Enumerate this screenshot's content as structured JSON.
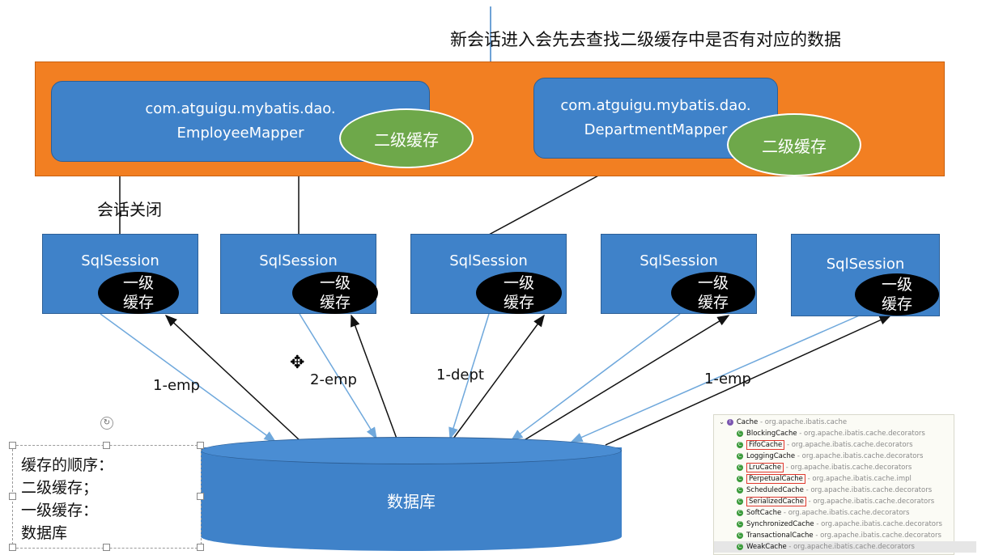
{
  "top_note": "新会话进入会先去查找二级缓存中是否有对应的数据",
  "mappers": [
    {
      "line1": "com.atguigu.mybatis.dao.",
      "line2": "EmployeeMapper",
      "cache": "二级缓存"
    },
    {
      "line1": "com.atguigu.mybatis.dao.",
      "line2": "DepartmentMapper",
      "cache": "二级缓存"
    }
  ],
  "session_close_label": "会话关闭",
  "sessions": [
    {
      "label": "SqlSession",
      "cache_line1": "一级",
      "cache_line2": "缓存"
    },
    {
      "label": "SqlSession",
      "cache_line1": "一级",
      "cache_line2": "缓存"
    },
    {
      "label": "SqlSession",
      "cache_line1": "一级",
      "cache_line2": "缓存"
    },
    {
      "label": "SqlSession",
      "cache_line1": "一级",
      "cache_line2": "缓存"
    },
    {
      "label": "SqlSession",
      "cache_line1": "一级",
      "cache_line2": "缓存"
    }
  ],
  "edge_labels": [
    "1-emp",
    "2-emp",
    "1-dept",
    "1-emp"
  ],
  "database_label": "数据库",
  "order_note": [
    "缓存的顺序：",
    "二级缓存；",
    "一级缓存：",
    "数据库"
  ],
  "class_tree": {
    "root": {
      "cls": "Cache",
      "pkg": " - org.apache.ibatis.cache"
    },
    "items": [
      {
        "cls": "BlockingCache",
        "pkg": " - org.apache.ibatis.cache.decorators",
        "boxed": false
      },
      {
        "cls": "FifoCache",
        "pkg": " - org.apache.ibatis.cache.decorators",
        "boxed": true
      },
      {
        "cls": "LoggingCache",
        "pkg": " - org.apache.ibatis.cache.decorators",
        "boxed": false
      },
      {
        "cls": "LruCache",
        "pkg": " - org.apache.ibatis.cache.decorators",
        "boxed": true
      },
      {
        "cls": "PerpetualCache",
        "pkg": " - org.apache.ibatis.cache.impl",
        "boxed": true
      },
      {
        "cls": "ScheduledCache",
        "pkg": " - org.apache.ibatis.cache.decorators",
        "boxed": false
      },
      {
        "cls": "SerializedCache",
        "pkg": " - org.apache.ibatis.cache.decorators",
        "boxed": true
      },
      {
        "cls": "SoftCache",
        "pkg": " - org.apache.ibatis.cache.decorators",
        "boxed": false
      },
      {
        "cls": "SynchronizedCache",
        "pkg": " - org.apache.ibatis.cache.decorators",
        "boxed": false
      },
      {
        "cls": "TransactionalCache",
        "pkg": " - org.apache.ibatis.cache.decorators",
        "boxed": false
      },
      {
        "cls": "WeakCache",
        "pkg": " - org.apache.ibatis.cache.decorators",
        "boxed": false,
        "selected": true
      }
    ]
  },
  "colors": {
    "orange": "#f27f22",
    "box_blue": "#3f82c9",
    "green": "#6ea84a",
    "arrow_blue": "#6fa8dc",
    "arrow_black": "#111111"
  }
}
